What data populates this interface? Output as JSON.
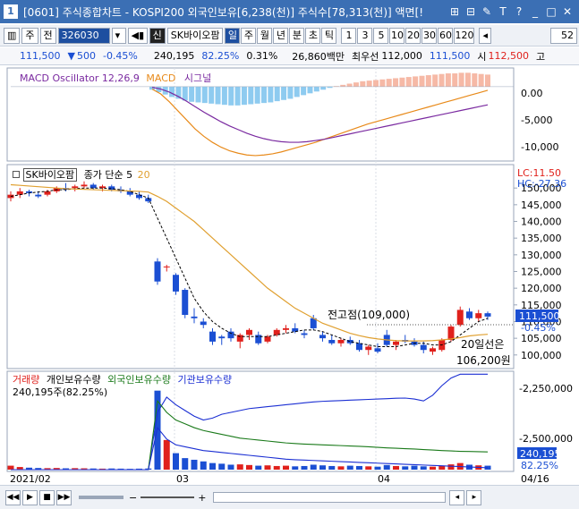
{
  "window": {
    "number": "1",
    "title": "[0601] 주식종합차트 - KOSPI200 외국인보유[6,238(천)] 주식수[78,313(천)] 액면[!",
    "controls": [
      "⊞",
      "⊟",
      "✎",
      "T",
      "?",
      "_",
      "□",
      "✕"
    ]
  },
  "toolbar": {
    "left_icon": "▥",
    "market": "주",
    "market_sel": "전",
    "code": "326030",
    "stock_name": "SK바이오팜",
    "shin": "신",
    "periods": [
      "일",
      "주",
      "월",
      "년",
      "분",
      "초",
      "틱"
    ],
    "active_period": 0,
    "counts": [
      "1",
      "3",
      "5",
      "10",
      "20",
      "30",
      "60",
      "120"
    ],
    "right_value": "52"
  },
  "quote": {
    "price": "111,500",
    "change_arrow": "▼",
    "change": "500",
    "change_pct": "-0.45%",
    "volume": "240,195",
    "foreign_pct": "82.25%",
    "turnover": "0.31%",
    "amount": "26,860백만",
    "priority_label": "최우선",
    "bid": "112,000",
    "ask": "111,500",
    "open_label": "시",
    "open": "112,500",
    "high_label": "고"
  },
  "macd": {
    "label_main": "MACD Oscillator 12,26,9",
    "label_macd": "MACD",
    "label_signal": "시그널",
    "axis": [
      "0.00",
      "-5,000",
      "-10,000"
    ]
  },
  "price_panel": {
    "stock_label": "SK바이오팜",
    "ma_label": "종가 단순",
    "ma5": "5",
    "ma20": "20",
    "lc": "LC:11.50",
    "hc": "HC:-27.36",
    "axis": [
      "150,000",
      "145,000",
      "140,000",
      "135,000",
      "130,000",
      "125,000",
      "120,000",
      "115,000",
      "110,000",
      "105,000",
      "100,000"
    ],
    "prev_high_label": "전고점(109,000)",
    "ma20_note_1": "20일선은",
    "ma20_note_2": "106,200원",
    "cur_price": "111,500",
    "cur_change": "-0.45%"
  },
  "volume_panel": {
    "label_vol": "거래량",
    "label_indiv": "개인보유수량",
    "label_foreign": "외국인보유수량",
    "label_inst": "기관보유수량",
    "stat": "240,195주(82.25%)",
    "axis": [
      "-2,250,000",
      "-2,500,000"
    ],
    "cur_vol": "240,195",
    "cur_pct": "82.25%"
  },
  "dates": [
    "2021/02",
    "03",
    "04",
    "04/16"
  ],
  "colors": {
    "up": "#e0211c",
    "down": "#1b4fd3",
    "macd": "#e88a1a",
    "signal": "#7a2aa0",
    "ma5": "#000000",
    "ma20": "#e0a030",
    "foreign": "#1a7a1a",
    "inst": "#1b2fd3",
    "osc_pos": "#f6b9a6",
    "osc_neg": "#8ecbf0"
  },
  "chart_data": [
    {
      "type": "bar",
      "series": [
        {
          "name": "MACD Oscillator 12,26,9",
          "values": [
            -500,
            -900,
            -1300,
            -1700,
            -2000,
            -2300,
            -2500,
            -2600,
            -2700,
            -2800,
            -2900,
            -3000,
            -3100,
            -3100,
            -3000,
            -2900,
            -2800,
            -2700,
            -2600,
            -2400,
            -2200,
            -2000,
            -1700,
            -1400,
            -1100,
            -800,
            -500,
            -200,
            100,
            300,
            500,
            700,
            900,
            1000,
            1100,
            1200,
            1300,
            1400,
            1500,
            1600,
            1700,
            1800,
            1900,
            2000,
            2100,
            2200,
            2200,
            2300,
            2300,
            2200,
            2100,
            2000
          ]
        }
      ],
      "ylim": [
        -12000,
        2500
      ]
    },
    {
      "type": "line",
      "series": [
        {
          "name": "MACD",
          "values": [
            -400,
            -1200,
            -2500,
            -4000,
            -5500,
            -7000,
            -8200,
            -9200,
            -10000,
            -10600,
            -11000,
            -11300,
            -11400,
            -11300,
            -11100,
            -10800,
            -10400,
            -10000,
            -9600,
            -9200,
            -8700,
            -8200,
            -7700,
            -7200,
            -6700,
            -6200,
            -5800,
            -5400,
            -5000,
            -4600,
            -4200,
            -3800,
            -3400,
            -3000,
            -2600,
            -2200,
            -1800,
            -1400,
            -1000,
            -600
          ]
        },
        {
          "name": "시그널",
          "values": [
            -100,
            -400,
            -900,
            -1600,
            -2400,
            -3300,
            -4200,
            -5000,
            -5800,
            -6500,
            -7100,
            -7700,
            -8200,
            -8600,
            -8900,
            -9100,
            -9200,
            -9200,
            -9100,
            -8900,
            -8700,
            -8400,
            -8100,
            -7800,
            -7500,
            -7200,
            -6900,
            -6600,
            -6300,
            -6000,
            -5700,
            -5400,
            -5100,
            -4800,
            -4500,
            -4200,
            -3900,
            -3600,
            -3300,
            -3000
          ]
        }
      ],
      "ylim": [
        -12000,
        2500
      ]
    },
    {
      "type": "candlestick",
      "ylim": [
        97000,
        153000
      ],
      "candles": [
        [
          147000,
          149000,
          146000,
          148000
        ],
        [
          148000,
          150000,
          147000,
          149000
        ],
        [
          149000,
          149500,
          147500,
          148500
        ],
        [
          148000,
          149000,
          147000,
          147500
        ],
        [
          148000,
          149500,
          147500,
          149000
        ],
        [
          149000,
          150500,
          148500,
          150000
        ],
        [
          150000,
          151500,
          149000,
          149500
        ],
        [
          150000,
          151000,
          149000,
          150500
        ],
        [
          150500,
          152000,
          150000,
          151000
        ],
        [
          151000,
          151500,
          149500,
          150000
        ],
        [
          150000,
          151000,
          149000,
          150500
        ],
        [
          150500,
          151000,
          149000,
          149500
        ],
        [
          149500,
          150500,
          148500,
          149000
        ],
        [
          149000,
          150000,
          147500,
          148000
        ],
        [
          148000,
          149000,
          146500,
          147000
        ],
        [
          147000,
          148000,
          145500,
          146000
        ],
        [
          128000,
          129000,
          121000,
          122000
        ],
        [
          126500,
          127000,
          125000,
          126500
        ],
        [
          124000,
          124500,
          118000,
          119000
        ],
        [
          119500,
          120000,
          111000,
          112000
        ],
        [
          111500,
          114000,
          109500,
          111000
        ],
        [
          110000,
          111000,
          108000,
          109000
        ],
        [
          107000,
          108000,
          103000,
          104000
        ],
        [
          105500,
          106000,
          103000,
          105000
        ],
        [
          107000,
          108000,
          104000,
          105000
        ],
        [
          104000,
          106500,
          102000,
          106000
        ],
        [
          106000,
          108000,
          104500,
          107500
        ],
        [
          106000,
          107000,
          103000,
          103500
        ],
        [
          104000,
          106000,
          103500,
          105500
        ],
        [
          106000,
          108000,
          105500,
          107500
        ],
        [
          107500,
          109000,
          106500,
          108000
        ],
        [
          108000,
          109500,
          106500,
          107000
        ],
        [
          106500,
          107500,
          105000,
          106000
        ],
        [
          111000,
          112000,
          107500,
          108000
        ],
        [
          106000,
          107000,
          104000,
          105000
        ],
        [
          104500,
          106000,
          103000,
          103500
        ],
        [
          103500,
          105000,
          102500,
          104500
        ],
        [
          104500,
          105500,
          103000,
          103500
        ],
        [
          103500,
          104500,
          101000,
          101500
        ],
        [
          101500,
          103000,
          100000,
          102500
        ],
        [
          102000,
          103500,
          100500,
          101000
        ],
        [
          106000,
          107500,
          102500,
          103000
        ],
        [
          103000,
          104500,
          101500,
          104000
        ],
        [
          104500,
          106000,
          103500,
          104000
        ],
        [
          104000,
          105000,
          102500,
          103000
        ],
        [
          103000,
          104000,
          100500,
          101500
        ],
        [
          101000,
          102500,
          100000,
          102000
        ],
        [
          101500,
          105000,
          101000,
          104500
        ],
        [
          104500,
          109000,
          104000,
          108500
        ],
        [
          109000,
          114500,
          108500,
          113500
        ],
        [
          113000,
          114000,
          110500,
          111000
        ],
        [
          111000,
          113500,
          110000,
          112500
        ],
        [
          112500,
          113000,
          110500,
          111500
        ]
      ],
      "ma5": [
        147500,
        148000,
        148500,
        148800,
        149000,
        149500,
        149500,
        149800,
        150000,
        150000,
        150000,
        149800,
        149500,
        149000,
        148000,
        147000,
        141000,
        135000,
        129000,
        123000,
        117000,
        113000,
        110000,
        108000,
        106500,
        105500,
        105500,
        105500,
        105500,
        106000,
        106500,
        107000,
        107500,
        107500,
        107000,
        106000,
        105000,
        104000,
        103500,
        103000,
        102500,
        102500,
        102500,
        103000,
        103500,
        103500,
        103000,
        103000,
        104000,
        106000,
        108000,
        110000,
        111000
      ],
      "ma20": [
        151000,
        150800,
        150600,
        150400,
        150200,
        150000,
        149800,
        149700,
        149600,
        149500,
        149400,
        149300,
        149200,
        149100,
        149000,
        148800,
        147500,
        146000,
        144000,
        142000,
        140000,
        137500,
        135000,
        132500,
        130000,
        127500,
        125000,
        122500,
        120000,
        118000,
        116000,
        114000,
        112500,
        111000,
        109500,
        108500,
        107500,
        106500,
        105800,
        105200,
        104800,
        104500,
        104300,
        104200,
        104200,
        104200,
        104300,
        104500,
        104800,
        105200,
        105700,
        106000,
        106200
      ]
    },
    {
      "type": "bar",
      "series": [
        {
          "name": "거래량",
          "values": [
            120,
            80,
            60,
            50,
            45,
            50,
            40,
            45,
            40,
            35,
            30,
            35,
            30,
            25,
            30,
            35,
            2400,
            900,
            500,
            350,
            300,
            250,
            200,
            180,
            150,
            160,
            140,
            120,
            130,
            110,
            120,
            100,
            110,
            150,
            130,
            110,
            100,
            120,
            110,
            100,
            90,
            140,
            110,
            100,
            120,
            100,
            90,
            120,
            160,
            200,
            150,
            130,
            120
          ]
        }
      ],
      "ylim": [
        0,
        2500
      ]
    },
    {
      "type": "line",
      "series": [
        {
          "name": "개인보유수량",
          "values": [
            -2600,
            -2600,
            -2600,
            -2600,
            -2600,
            -2600,
            -2600,
            -2600,
            -2600,
            -2600,
            -2600,
            -2600,
            -2600,
            -2600,
            -2600,
            -2600,
            -2300,
            -2220,
            -2260,
            -2290,
            -2320,
            -2340,
            -2330,
            -2310,
            -2300,
            -2290,
            -2280,
            -2275,
            -2270,
            -2265,
            -2260,
            -2255,
            -2250,
            -2245,
            -2242,
            -2240,
            -2238,
            -2236,
            -2234,
            -2232,
            -2230,
            -2228,
            -2226,
            -2225,
            -2230,
            -2240,
            -2210,
            -2160,
            -2120,
            -2100,
            -2100,
            -2100,
            -2100
          ]
        },
        {
          "name": "외국인보유수량",
          "values": [
            -2600,
            -2600,
            -2600,
            -2600,
            -2600,
            -2600,
            -2600,
            -2600,
            -2600,
            -2600,
            -2600,
            -2600,
            -2600,
            -2600,
            -2600,
            -2600,
            -2240,
            -2300,
            -2340,
            -2360,
            -2380,
            -2395,
            -2405,
            -2415,
            -2425,
            -2435,
            -2440,
            -2445,
            -2450,
            -2455,
            -2460,
            -2463,
            -2466,
            -2468,
            -2470,
            -2472,
            -2474,
            -2476,
            -2478,
            -2480,
            -2483,
            -2486,
            -2488,
            -2490,
            -2492,
            -2495,
            -2497,
            -2500,
            -2502,
            -2504,
            -2505,
            -2506,
            -2507
          ]
        },
        {
          "name": "기관보유수량",
          "values": [
            -2600,
            -2600,
            -2600,
            -2600,
            -2600,
            -2600,
            -2600,
            -2600,
            -2600,
            -2600,
            -2600,
            -2600,
            -2600,
            -2600,
            -2600,
            -2600,
            -2380,
            -2440,
            -2470,
            -2480,
            -2490,
            -2500,
            -2505,
            -2510,
            -2515,
            -2520,
            -2525,
            -2530,
            -2535,
            -2540,
            -2545,
            -2548,
            -2550,
            -2552,
            -2554,
            -2556,
            -2558,
            -2560,
            -2562,
            -2564,
            -2566,
            -2568,
            -2570,
            -2572,
            -2574,
            -2576,
            -2578,
            -2580,
            -2582,
            -2584,
            -2586,
            -2588,
            -2590
          ]
        }
      ],
      "ylim": [
        -2600,
        -2150
      ]
    }
  ]
}
